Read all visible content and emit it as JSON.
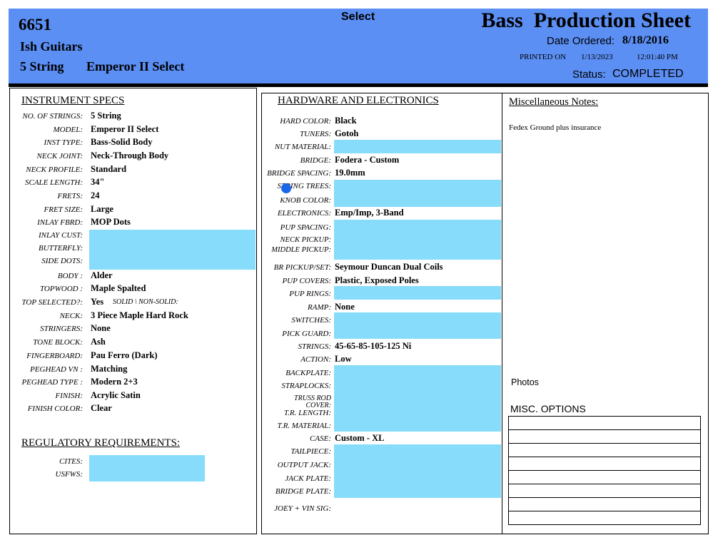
{
  "header": {
    "order_number": "6651",
    "customer": "Ish Guitars",
    "strings": "5 String",
    "model": "Emperor II Select",
    "series": "Select",
    "title": "Bass  Production Sheet",
    "date_ordered_label": "Date Ordered:",
    "date_ordered": "8/18/2016",
    "printed_on_label": "PRINTED ON",
    "printed_date": "1/13/2023",
    "printed_time": "12:01:40 PM",
    "status_label": "Status:",
    "status": "COMPLETED"
  },
  "specs": {
    "title": "INSTRUMENT SPECS",
    "rows": [
      {
        "label": "NO. OF STRINGS:",
        "value": "5 String"
      },
      {
        "label": "MODEL:",
        "value": "Emperor II Select"
      },
      {
        "label": "INST TYPE:",
        "value": "Bass-Solid Body"
      },
      {
        "label": "NECK JOINT:",
        "value": "Neck-Through Body"
      },
      {
        "label": "NECK PROFILE:",
        "value": "Standard"
      },
      {
        "label": "SCALE LENGTH:",
        "value": "34\""
      },
      {
        "label": "FRETS:",
        "value": "24"
      },
      {
        "label": "FRET SIZE:",
        "value": "Large"
      },
      {
        "label": "INLAY FBRD:",
        "value": "MOP Dots"
      },
      {
        "label": "INLAY CUST:",
        "value": ""
      },
      {
        "label": "BUTTERFLY:",
        "value": ""
      },
      {
        "label": "SIDE DOTS:",
        "value": ""
      },
      {
        "label": "BODY :",
        "value": "Alder"
      },
      {
        "label": "TOPWOOD :",
        "value": "Maple Spalted"
      },
      {
        "label": "TOP SELECTED?:",
        "value": "Yes"
      },
      {
        "label": "NECK:",
        "value": "3 Piece Maple Hard Rock"
      },
      {
        "label": "STRINGERS:",
        "value": "None"
      },
      {
        "label": "TONE BLOCK:",
        "value": "Ash"
      },
      {
        "label": "FINGERBOARD:",
        "value": "Pau Ferro (Dark)"
      },
      {
        "label": "PEGHEAD VN :",
        "value": "Matching"
      },
      {
        "label": "PEGHEAD TYPE :",
        "value": "Modern 2+3"
      },
      {
        "label": "FINISH:",
        "value": "Acrylic Satin"
      },
      {
        "label": "FINISH COLOR:",
        "value": "Clear"
      }
    ],
    "top_solid_options": "SOLID \\ NON-SOLID:"
  },
  "regulatory": {
    "title": "REGULATORY REQUIREMENTS:",
    "rows": [
      {
        "label": "CITES:",
        "value": ""
      },
      {
        "label": "USFWS:",
        "value": ""
      }
    ]
  },
  "hardware": {
    "title": "HARDWARE AND ELECTRONICS",
    "rows": [
      {
        "label": "HARD COLOR:",
        "value": "Black"
      },
      {
        "label": "TUNERS:",
        "value": "Gotoh"
      },
      {
        "label": "NUT MATERIAL:",
        "value": ""
      },
      {
        "label": "BRIDGE:",
        "value": "Fodera - Custom"
      },
      {
        "label": "BRIDGE SPACING:",
        "value": "19.0mm"
      },
      {
        "label": "STRING TREES:",
        "value": ""
      },
      {
        "label": "KNOB COLOR:",
        "value": ""
      },
      {
        "label": "ELECTRONICS:",
        "value": "Emp/Imp, 3-Band"
      },
      {
        "label": "PUP SPACING:",
        "value": ""
      },
      {
        "label": "NECK PICKUP:",
        "value": ""
      },
      {
        "label": "MIDDLE PICKUP:",
        "value": ""
      },
      {
        "label": "BR PICKUP/SET:",
        "value": "Seymour Duncan Dual Coils"
      },
      {
        "label": "PUP COVERS:",
        "value": "Plastic, Exposed Poles"
      },
      {
        "label": "PUP RINGS:",
        "value": ""
      },
      {
        "label": "RAMP:",
        "value": "None"
      },
      {
        "label": "SWITCHES:",
        "value": ""
      },
      {
        "label": "PICK GUARD:",
        "value": ""
      },
      {
        "label": "STRINGS:",
        "value": "45-65-85-105-125 Ni"
      },
      {
        "label": "ACTION:",
        "value": "Low"
      },
      {
        "label": "BACKPLATE:",
        "value": ""
      },
      {
        "label": "STRAPLOCKS:",
        "value": ""
      },
      {
        "label": "TRUSS ROD",
        "value": ""
      },
      {
        "label": "COVER:",
        "value": ""
      },
      {
        "label": "T.R. LENGTH:",
        "value": ""
      },
      {
        "label": "T.R. MATERIAL:",
        "value": ""
      },
      {
        "label": "CASE:",
        "value": "Custom - XL"
      },
      {
        "label": "TAILPIECE:",
        "value": ""
      },
      {
        "label": "OUTPUT JACK:",
        "value": ""
      },
      {
        "label": "JACK PLATE:",
        "value": ""
      },
      {
        "label": "BRIDGE PLATE:",
        "value": ""
      },
      {
        "label": "JOEY + VIN SIG:",
        "value": ""
      }
    ]
  },
  "misc": {
    "notes_title": "Miscellaneous Notes:",
    "notes": "Fedex Ground plus insurance",
    "photos_label": "Photos",
    "options_title": "MISC. OPTIONS"
  },
  "colors": {
    "header_bg": "#5b8ff4",
    "highlight": "#87dcfb",
    "cursor": "#1967e8"
  }
}
